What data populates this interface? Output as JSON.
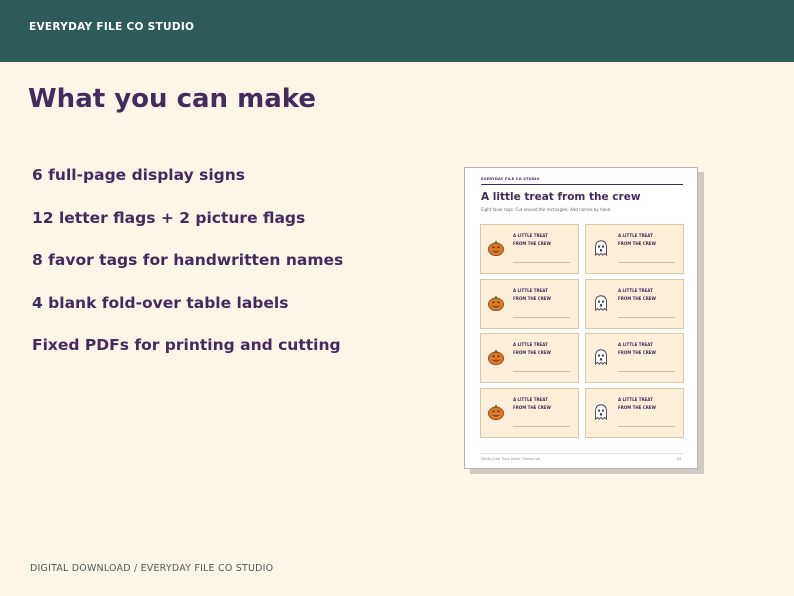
{
  "header": {
    "brand": "EVERYDAY FILE CO STUDIO"
  },
  "main": {
    "title": "What you can make",
    "features": [
      "6 full-page display signs",
      "12 letter flags + 2 picture flags",
      "8 favor tags for handwritten names",
      "4 blank fold-over table labels",
      "Fixed PDFs for printing and cutting"
    ]
  },
  "preview": {
    "brand": "EVERYDAY FILE CO STUDIO",
    "title": "A little treat from the crew",
    "subtitle": "Eight favor tags. Cut around the rectangles. Add names by hand.",
    "tag_line1": "A LITTLE TREAT",
    "tag_line2": "FROM THE CREW",
    "tags": [
      {
        "icon": "pumpkin-icon"
      },
      {
        "icon": "ghost-icon"
      },
      {
        "icon": "pumpkin-icon"
      },
      {
        "icon": "ghost-icon"
      },
      {
        "icon": "pumpkin-icon"
      },
      {
        "icon": "ghost-icon"
      },
      {
        "icon": "pumpkin-icon"
      },
      {
        "icon": "ghost-icon"
      }
    ],
    "footer_left": "Family Crew Trunk Decor | Favour set",
    "footer_right": "04"
  },
  "footer": {
    "text": "DIGITAL DOWNLOAD / EVERYDAY FILE CO STUDIO"
  },
  "colors": {
    "header_bg": "#2c5b58",
    "page_bg": "#fdf5e8",
    "accent": "#452a5e",
    "tag_bg": "#fbefd9",
    "pumpkin": "#d9782b"
  }
}
